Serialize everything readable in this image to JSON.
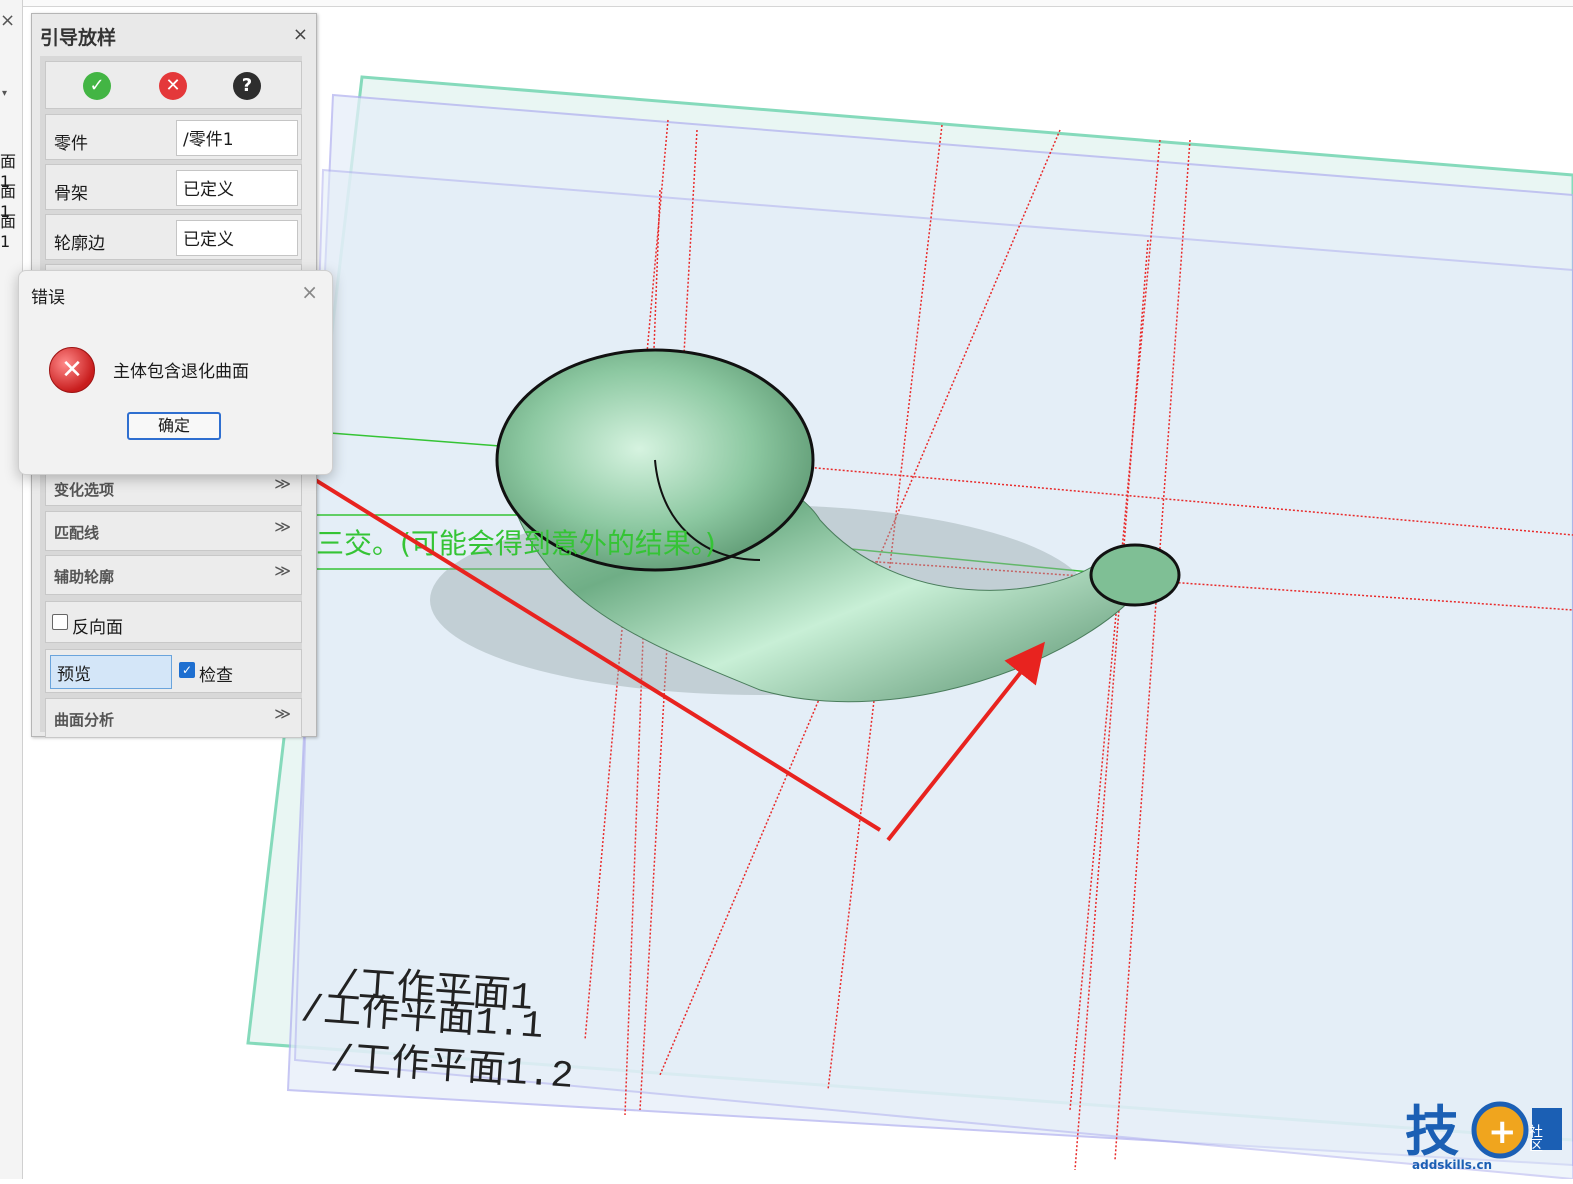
{
  "left_strip": {
    "close_glyph": "×",
    "dropdown_glyph": "▾",
    "rows": [
      "面1",
      "面1",
      "面1"
    ]
  },
  "panel": {
    "title": "引导放样",
    "close_glyph": "×",
    "actions": {
      "ok_glyph": "✓",
      "cancel_glyph": "✕",
      "help_glyph": "?"
    },
    "fields": [
      {
        "label": "零件",
        "value": "/零件1"
      },
      {
        "label": "骨架",
        "value": "已定义"
      },
      {
        "label": "轮廓边",
        "value": "已定义"
      }
    ],
    "sections": [
      "变化选项",
      "匹配线",
      "辅助轮廓"
    ],
    "reverse_face": {
      "label": "反向面",
      "checked": false
    },
    "preview_label": "预览",
    "check": {
      "label": "检查",
      "checked": true
    },
    "analysis_label": "曲面分析",
    "chevron_glyph": "≫"
  },
  "dialog": {
    "title": "错误",
    "close_glyph": "×",
    "icon_glyph": "✕",
    "message": "主体包含退化曲面",
    "ok_label": "确定"
  },
  "viewport": {
    "plane_labels": [
      "/工作平面1",
      "/工作平面1.1",
      "/工作平面1.2"
    ],
    "warning_text": "三交。(可能会得到意外的结果。)"
  },
  "watermark": {
    "logo_text": "技",
    "side_text": "社区",
    "url": "addskills.cn"
  }
}
